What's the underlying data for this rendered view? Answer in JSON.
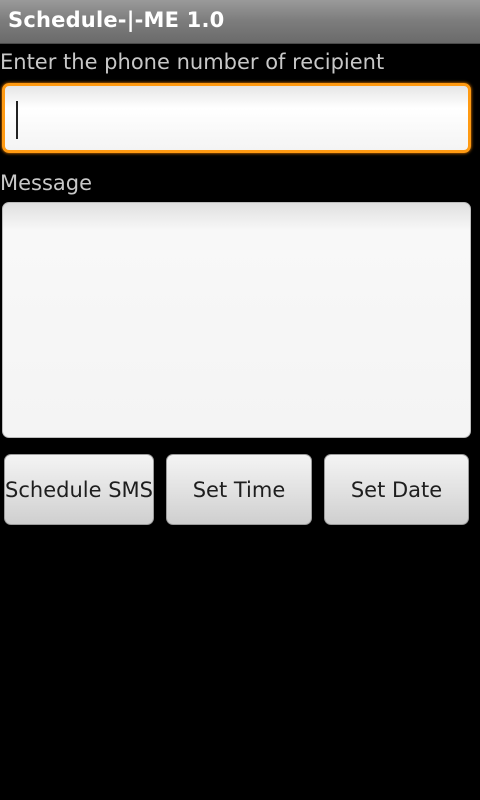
{
  "app": {
    "title": "Schedule-|-ME 1.0"
  },
  "form": {
    "phone_label": "Enter the phone number of recipient",
    "phone_value": "",
    "message_label": "Message",
    "message_value": ""
  },
  "actions": {
    "schedule_label": "Schedule SMS",
    "set_time_label": "Set Time",
    "set_date_label": "Set Date"
  },
  "colors": {
    "focus_accent": "#ff9a12",
    "background": "#000000"
  }
}
